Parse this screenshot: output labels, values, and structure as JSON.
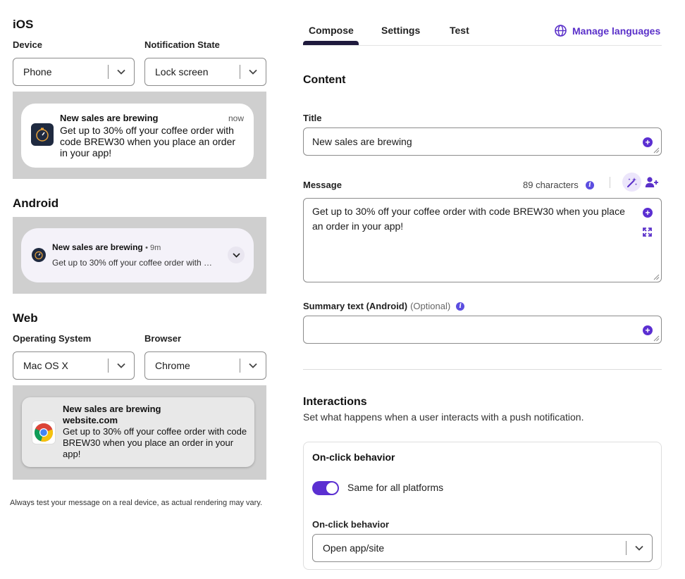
{
  "left": {
    "ios": {
      "title": "iOS",
      "device_label": "Device",
      "device_value": "Phone",
      "state_label": "Notification State",
      "state_value": "Lock screen",
      "notif_title": "New sales are brewing",
      "notif_time": "now",
      "notif_body": "Get up to 30% off your coffee order with code BREW30 when you place an order in your app!"
    },
    "android": {
      "title": "Android",
      "notif_title": "New sales are brewing",
      "notif_time": "• 9m",
      "notif_body": "Get up to 30% off your coffee order with …"
    },
    "web": {
      "title": "Web",
      "os_label": "Operating System",
      "os_value": "Mac OS X",
      "browser_label": "Browser",
      "browser_value": "Chrome",
      "notif_title": "New sales are brewing",
      "notif_site": "website.com",
      "notif_body": "Get up to 30% off your coffee order with code BREW30 when you place an order in your app!"
    },
    "disclaimer": "Always test your message on a real device, as actual rendering may vary."
  },
  "right": {
    "tabs": [
      {
        "label": "Compose"
      },
      {
        "label": "Settings"
      },
      {
        "label": "Test"
      }
    ],
    "manage_languages": "Manage languages",
    "content_heading": "Content",
    "title_label": "Title",
    "title_value": "New sales are brewing",
    "message_label": "Message",
    "char_count": "89 characters",
    "message_value": "Get up to 30% off your coffee order with code BREW30 when you place an order in your app!",
    "summary_label": "Summary text (Android)",
    "summary_optional": "(Optional)",
    "summary_value": "",
    "interactions_heading": "Interactions",
    "interactions_desc": "Set what happens when a user interacts with a push notification.",
    "onclick_card_title": "On-click behavior",
    "toggle_label": "Same for all platforms",
    "toggle_on": true,
    "onclick_label": "On-click behavior",
    "onclick_value": "Open app/site"
  },
  "colors": {
    "accent": "#5b2fd1",
    "tab_underline": "#1f1a3d",
    "preview_bg": "#cfcfcf"
  }
}
